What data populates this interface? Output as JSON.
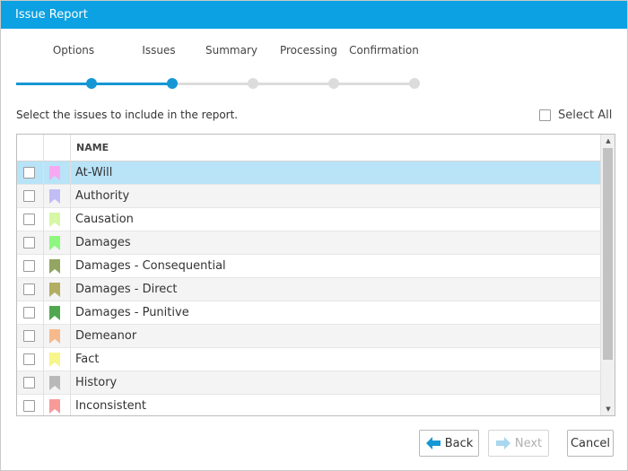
{
  "window": {
    "title": "Issue Report"
  },
  "wizard": {
    "steps": [
      {
        "label": "Options",
        "state": "done"
      },
      {
        "label": "Issues",
        "state": "current"
      },
      {
        "label": "Summary",
        "state": "pending"
      },
      {
        "label": "Processing",
        "state": "pending"
      },
      {
        "label": "Confirmation",
        "state": "pending"
      }
    ],
    "accent_color": "#1597d5"
  },
  "instruction": "Select the issues to include in the report.",
  "select_all": {
    "label": "Select All",
    "checked": false
  },
  "grid": {
    "columns": [
      "NAME"
    ],
    "rows": [
      {
        "name": "At-Will",
        "color": "#f7a8f2",
        "selected": true
      },
      {
        "name": "Authority",
        "color": "#c2bdf7"
      },
      {
        "name": "Causation",
        "color": "#d6f7a3"
      },
      {
        "name": "Damages",
        "color": "#8ef77f"
      },
      {
        "name": "Damages - Consequential",
        "color": "#93a561"
      },
      {
        "name": "Damages - Direct",
        "color": "#b4ae62"
      },
      {
        "name": "Damages - Punitive",
        "color": "#4fa84f"
      },
      {
        "name": "Demeanor",
        "color": "#f7b98b"
      },
      {
        "name": "Fact",
        "color": "#f7f58b"
      },
      {
        "name": "History",
        "color": "#b9b9b9"
      },
      {
        "name": "Inconsistent",
        "color": "#f79a9a"
      }
    ]
  },
  "buttons": {
    "back": "Back",
    "next": "Next",
    "cancel": "Cancel",
    "back_icon_color": "#1597d5",
    "next_icon_color": "#a9d7ef"
  }
}
